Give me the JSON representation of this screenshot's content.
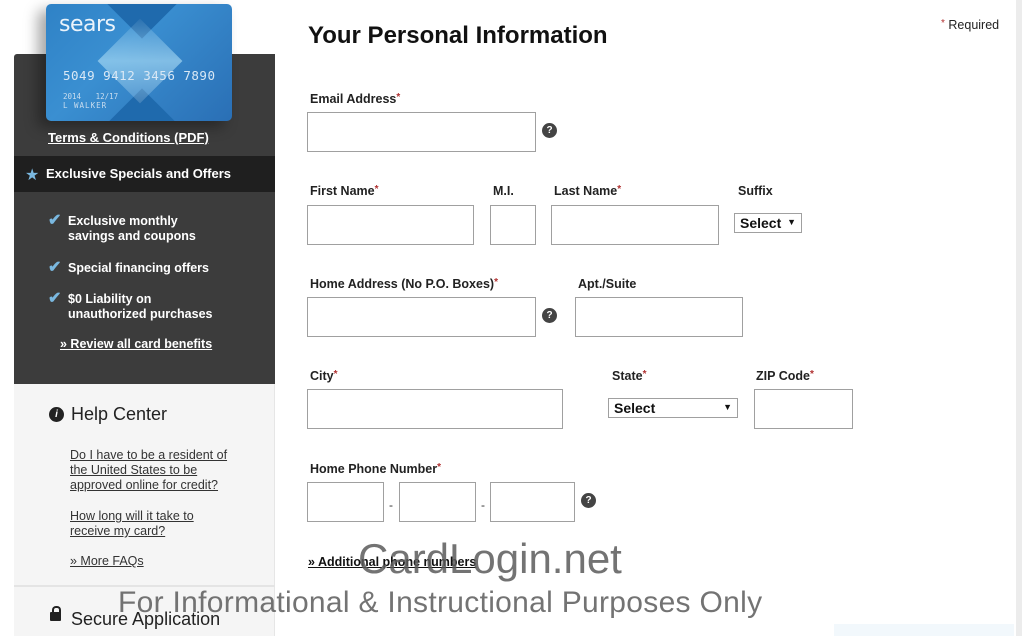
{
  "sidebar": {
    "card": {
      "brand": "sears",
      "number": "5049 9412 3456 7890",
      "member_since": "2014",
      "valid_thru": "12/17",
      "name": "L WALKER"
    },
    "terms_link": "Terms & Conditions (PDF)",
    "offers_title": "Exclusive Specials and Offers",
    "benefits": [
      "Exclusive monthly savings and coupons",
      "Special financing offers",
      "$0 Liability on unauthorized purchases"
    ],
    "review_link": "» Review all card benefits",
    "help": {
      "title": "Help Center",
      "faqs": [
        "Do I have to be a resident of the United States to be approved online for credit?",
        "How long will it take to receive my card?"
      ],
      "more_link": "» More FAQs"
    },
    "secure_title": "Secure Application"
  },
  "main": {
    "title": "Your Personal Information",
    "required_note": "Required",
    "required_mark": "*",
    "fields": {
      "email": {
        "label": "Email Address",
        "value": ""
      },
      "first_name": {
        "label": "First Name",
        "value": ""
      },
      "mi": {
        "label": "M.I.",
        "value": ""
      },
      "last_name": {
        "label": "Last Name",
        "value": ""
      },
      "suffix": {
        "label": "Suffix",
        "selected": "Select"
      },
      "home_address": {
        "label": "Home Address (No P.O. Boxes)",
        "value": ""
      },
      "apt": {
        "label": "Apt./Suite",
        "value": ""
      },
      "city": {
        "label": "City",
        "value": ""
      },
      "state": {
        "label": "State",
        "selected": "Select"
      },
      "zip": {
        "label": "ZIP Code",
        "value": ""
      },
      "phone": {
        "label": "Home Phone Number",
        "separator": "-"
      }
    },
    "additional_phone_link": "» Additional phone numbers",
    "help_glyph": "?",
    "dropdown_arrow": "▼"
  },
  "watermark": {
    "line1": "CardLogin.net",
    "line2": "For Informational & Instructional Purposes Only"
  },
  "icons": {
    "star": "★",
    "check": "✔",
    "info": "i"
  }
}
